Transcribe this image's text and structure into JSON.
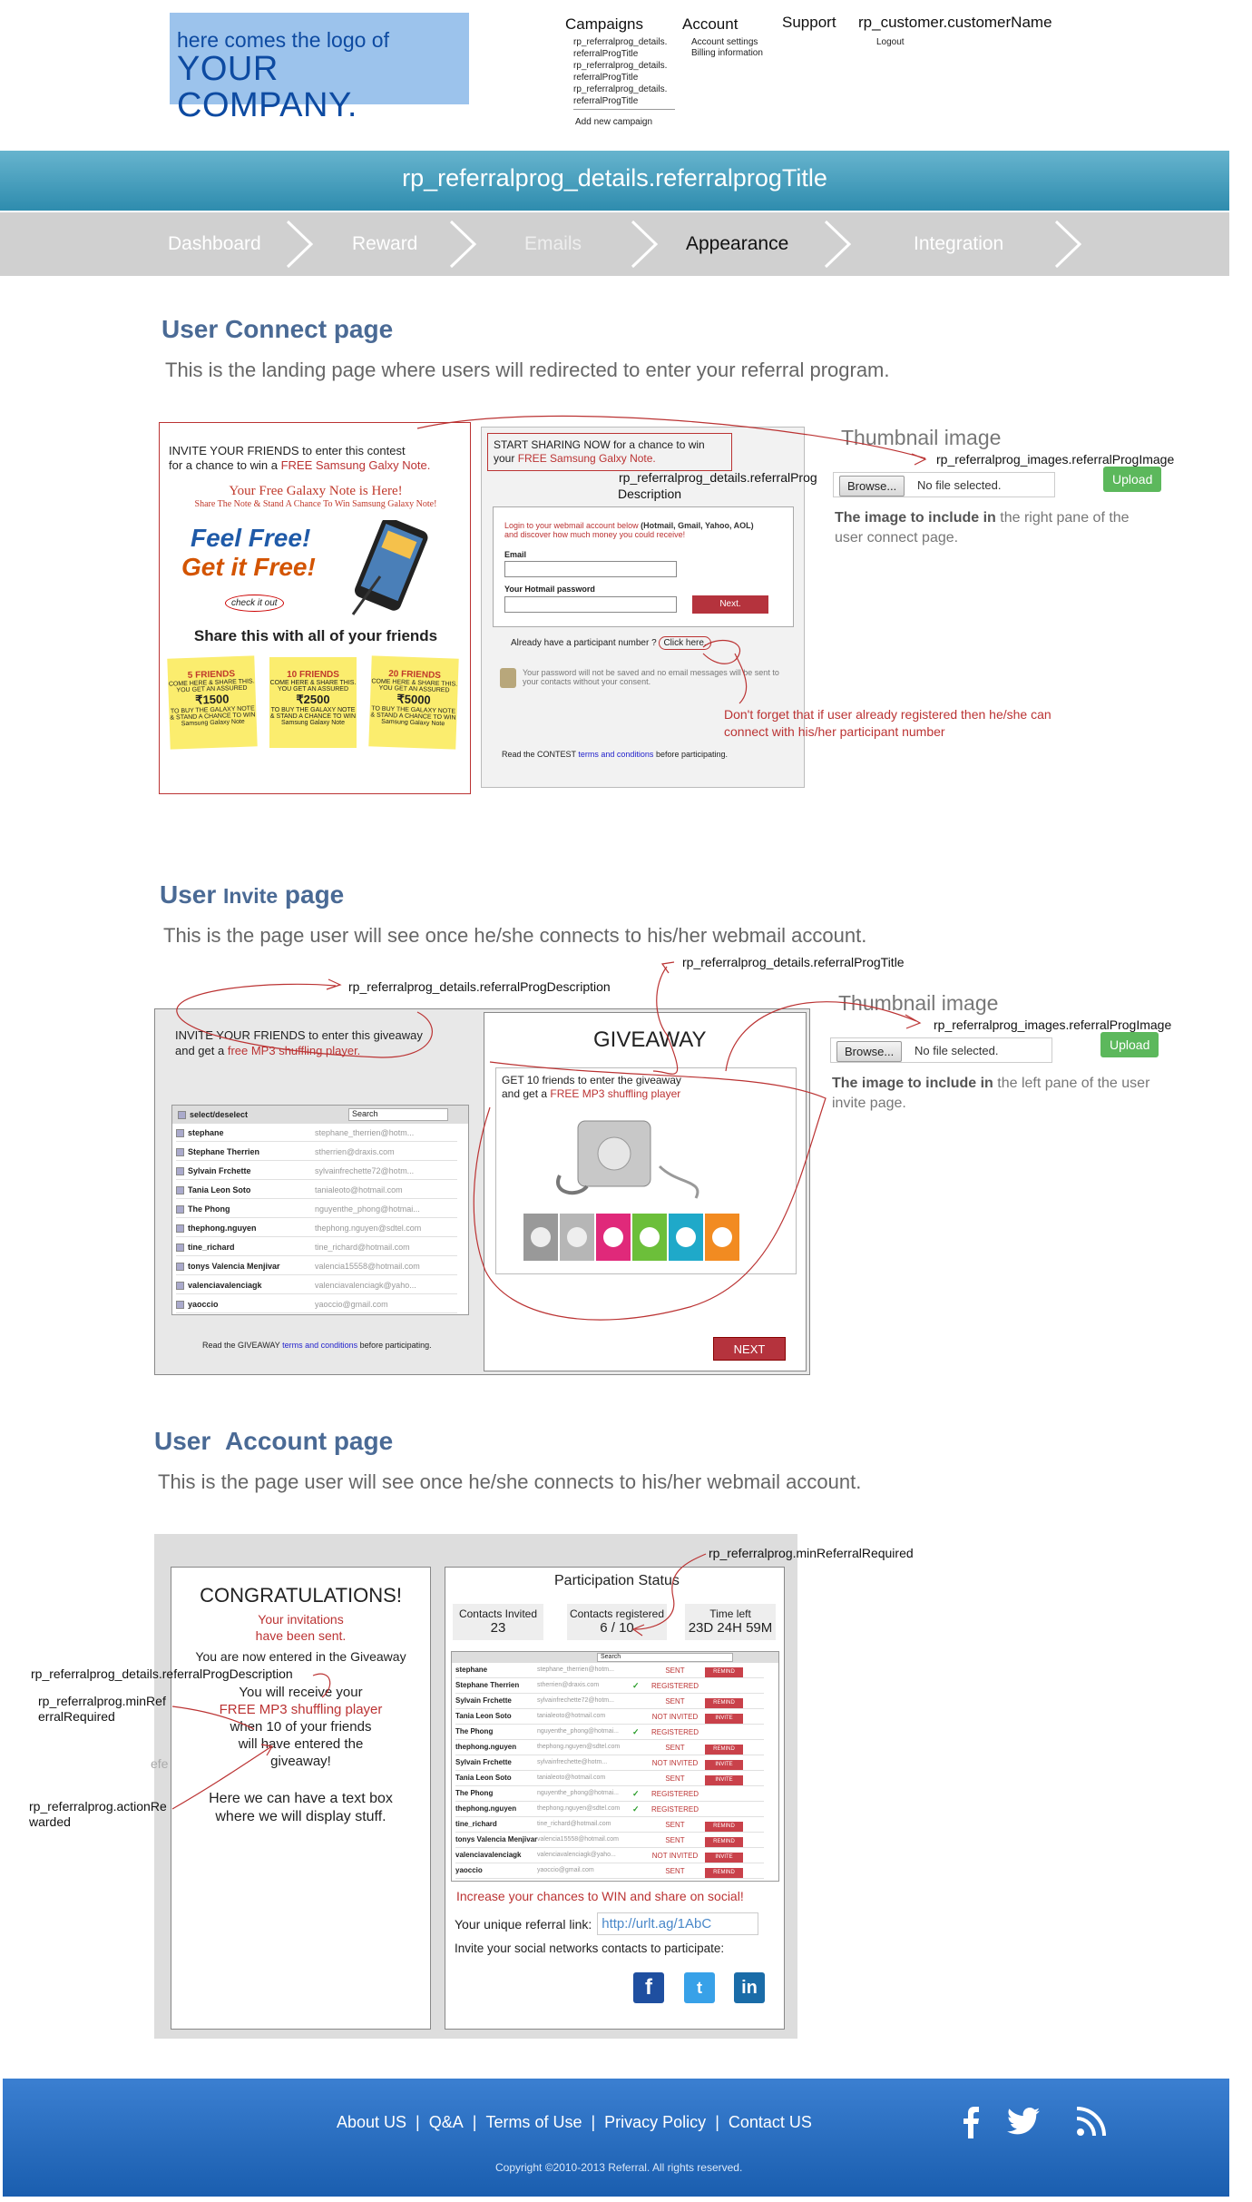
{
  "header": {
    "logo": {
      "line1": "here comes the logo of",
      "line2": "YOUR COMPANY."
    },
    "menu": {
      "campaigns": "Campaigns",
      "account": "Account",
      "support": "Support",
      "customer": "rp_customer.customerName"
    },
    "campaign_items": [
      "rp_referralprog_details.",
      "referralProgTitle",
      "rp_referralprog_details.",
      "referralProgTitle",
      "rp_referralprog_details.",
      "referralProgTitle"
    ],
    "add_campaign": "Add new campaign",
    "account_items": [
      "Account settings",
      "Billing information"
    ],
    "logout": "Logout"
  },
  "title_band": "rp_referralprog_details.referralprogTitle",
  "steps": [
    {
      "label": "Dashboard",
      "active": false
    },
    {
      "label": "Reward",
      "active": false
    },
    {
      "label": "Emails",
      "active": false
    },
    {
      "label": "Appearance",
      "active": true
    },
    {
      "label": "Integration",
      "active": false
    }
  ],
  "sections": {
    "connect": {
      "title": "User Connect page",
      "description": "This is the landing page where users will redirected to enter your referral program.",
      "thumb_title": "Thumbnail image",
      "image_field": "rp_referralprog_images.referralProgImage",
      "browse": "Browse...",
      "no_file": "No file selected.",
      "upload": "Upload",
      "help_strong": "The image to include in",
      "help_rest": "the right pane of the user connect page.",
      "desc_annotation_1": "rp_referralprog_details.referralProg",
      "desc_annotation_2": "Description",
      "note": "Don't forget that if user already registered then he/she can connect with his/her participant number",
      "left": {
        "invite_a": "INVITE YOUR FRIENDS to enter this contest",
        "invite_b": "for a chance to win a",
        "invite_c": "FREE Samsung Galxy Note.",
        "promo_title": "Your Free Galaxy Note is Here!",
        "promo_sub": "Share The Note & Stand A Chance To Win Samsung Galaxy Note!",
        "feel": "Feel Free!",
        "get": "Get it Free!",
        "check": "check it out",
        "share": "Share this with all of your friends",
        "notes": [
          {
            "head": "5 FRIENDS",
            "amount": "₹1500"
          },
          {
            "head": "10 FRIENDS",
            "amount": "₹2500"
          },
          {
            "head": "20 FRIENDS",
            "amount": "₹5000"
          }
        ],
        "note_body": "COME HERE & SHARE THIS. YOU GET AN ASSURED",
        "note_tail": "TO BUY THE GALAXY NOTE & STAND A CHANCE TO WIN",
        "note_brand": "Samsung Galaxy Note"
      },
      "right": {
        "start_a": "START SHARING NOW for a chance to win",
        "start_b": "your",
        "start_c": "FREE Samsung Galxy Note.",
        "login_a": "Login to your webmail account below",
        "login_b": "(Hotmail, Gmail, Yahoo, AOL)",
        "login_c": "and discover how much money you could receive!",
        "email_label": "Email",
        "pwd_label": "Your Hotmail password",
        "next": "Next.",
        "participant": "Already have a participant number ?",
        "click_here": "Click here.",
        "privacy": "Your password will not be saved and no email messages will be sent to your contacts without your consent.",
        "contest_a": "Read the CONTEST",
        "contest_link": "terms and conditions",
        "contest_b": "before participating."
      }
    },
    "invite": {
      "title_a": "User",
      "title_b": "Invite",
      "title_c": "page",
      "description": "This is the  page user will see once he/she connects to his/her webmail account.",
      "ann_title": "rp_referralprog_details.referralProgTitle",
      "ann_desc": "rp_referralprog_details.referralProgDescription",
      "thumb_title": "Thumbnail image",
      "image_field": "rp_referralprog_images.referralProgImage",
      "browse": "Browse...",
      "no_file": "No file selected.",
      "upload": "Upload",
      "help_strong": "The image to include in",
      "help_rest_a": "the",
      "help_rest_b": "left",
      "help_rest_c": "pane of the user invite page.",
      "left": {
        "invite_a": "INVITE YOUR FRIENDS to enter this giveaway",
        "invite_b": "and get a",
        "invite_c": "free MP3 shuffling player.",
        "select": "select/deselect",
        "search": "Search",
        "contacts": [
          {
            "name": "stephane",
            "email": "stephane_therrien@hotm..."
          },
          {
            "name": "Stephane Therrien",
            "email": "stherrien@draxis.com"
          },
          {
            "name": "Sylvain Frchette",
            "email": "sylvainfrechette72@hotm..."
          },
          {
            "name": "Tania Leon Soto",
            "email": "tanialeoto@hotmail.com"
          },
          {
            "name": "The Phong",
            "email": "nguyenthe_phong@hotmai..."
          },
          {
            "name": "thephong.nguyen",
            "email": "thephong.nguyen@sdtel.com"
          },
          {
            "name": "tine_richard",
            "email": "tine_richard@hotmail.com"
          },
          {
            "name": "tonys Valencia Menjivar",
            "email": "valencia15558@hotmail.com"
          },
          {
            "name": "valenciavalenciagk",
            "email": "valenciavalenciagk@yaho..."
          },
          {
            "name": "yaoccio",
            "email": "yaoccio@gmail.com"
          }
        ],
        "terms_a": "Read the GIVEAWAY",
        "terms_link": "terms and conditions",
        "terms_b": "before participating."
      },
      "right": {
        "giveaway": "GIVEAWAY",
        "get_a": "GET 10 friends to enter the giveaway",
        "get_b": "and get a",
        "get_c": "FREE MP3 shuffling player",
        "next": "NEXT"
      }
    },
    "account": {
      "title_a": "User",
      "title_b": "Account",
      "title_c": "page",
      "description": "This is the  page user will see once he/she connects to his/her webmail account.",
      "ann_min": "rp_referralprog.minReferralRequired",
      "ann_desc": "rp_referralprog_details.referralProgDescription",
      "ann_min_left_a": "rp_referralprog.minRef",
      "ann_min_left_b": "erralRequired",
      "ann_action_a": "rp_referralprog.actionRe",
      "ann_action_b": "warded",
      "ann_fragment": "efe",
      "left": {
        "congrats": "CONGRATULATIONS!",
        "sent_a": "Your invitations",
        "sent_b": "have been sent.",
        "entered": "You are now entered in the Giveaway",
        "receive_a": "You will receive your",
        "receive_b": "FREE MP3 shuffling player",
        "receive_c": "when 10 of your friends",
        "receive_d": "will have entered the",
        "receive_e": "giveaway!",
        "textbox_a": "Here we can have a text box",
        "textbox_b": "where we will display stuff."
      },
      "right": {
        "status_title": "Participation Status",
        "stats": [
          {
            "label": "Contacts Invited",
            "value": "23"
          },
          {
            "label": "Contacts registered",
            "value": "6 / 10"
          },
          {
            "label": "Time left",
            "value": "23D 24H 59M"
          }
        ],
        "search": "Search",
        "rows": [
          {
            "name": "stephane",
            "email": "stephane_therrien@hotm...",
            "status": "SENT",
            "action": "REMIND",
            "check": false
          },
          {
            "name": "Stephane Therrien",
            "email": "stherrien@draxis.com",
            "status": "REGISTERED",
            "action": "",
            "check": true
          },
          {
            "name": "Sylvain Frchette",
            "email": "sylvainfrechette72@hotm...",
            "status": "SENT",
            "action": "REMIND",
            "check": false
          },
          {
            "name": "Tania Leon Soto",
            "email": "tanialeoto@hotmail.com",
            "status": "NOT INVITED",
            "action": "INVITE",
            "check": false
          },
          {
            "name": "The Phong",
            "email": "nguyenthe_phong@hotmai...",
            "status": "REGISTERED",
            "action": "",
            "check": true
          },
          {
            "name": "thephong.nguyen",
            "email": "thephong.nguyen@sdtel.com",
            "status": "SENT",
            "action": "REMIND",
            "check": false
          },
          {
            "name": "Sylvain Frchette",
            "email": "sylvainfrechette@hotm...",
            "status": "NOT INVITED",
            "action": "INVITE",
            "check": false
          },
          {
            "name": "Tania Leon Soto",
            "email": "tanialeoto@hotmail.com",
            "status": "SENT",
            "action": "INVITE",
            "check": false
          },
          {
            "name": "The Phong",
            "email": "nguyenthe_phong@hotmai...",
            "status": "REGISTERED",
            "action": "",
            "check": true
          },
          {
            "name": "thephong.nguyen",
            "email": "thephong.nguyen@sdtel.com",
            "status": "REGISTERED",
            "action": "",
            "check": true
          },
          {
            "name": "tine_richard",
            "email": "tine_richard@hotmail.com",
            "status": "SENT",
            "action": "REMIND",
            "check": false
          },
          {
            "name": "tonys Valencia Menjivar",
            "email": "valencia15558@hotmail.com",
            "status": "SENT",
            "action": "REMIND",
            "check": false
          },
          {
            "name": "valenciavalenciagk",
            "email": "valenciavalenciagk@yaho...",
            "status": "NOT INVITED",
            "action": "INVITE",
            "check": false
          },
          {
            "name": "yaoccio",
            "email": "yaoccio@gmail.com",
            "status": "SENT",
            "action": "REMIND",
            "check": false
          }
        ],
        "increase": "Increase your chances to WIN and share on social!",
        "link_label": "Your unique referral link:",
        "link_value": "http://urlt.ag/1AbC",
        "social_label": "Invite your social networks contacts to participate:",
        "social": [
          "f",
          "t",
          "in"
        ]
      }
    }
  },
  "footer": {
    "links": [
      "About  US",
      "Q&A",
      "Terms of Use",
      "Privacy Policy",
      "Contact US"
    ],
    "copyright": "Copyright ©2010-2013 Referral. All rights reserved.",
    "icons": [
      "facebook-icon",
      "twitter-icon",
      "rss-icon"
    ]
  },
  "colors": {
    "accent": "#4a6a95",
    "band": "#3f9bbd",
    "red": "#b33333",
    "green": "#5cb85c",
    "footer": "#2a6fc4"
  }
}
